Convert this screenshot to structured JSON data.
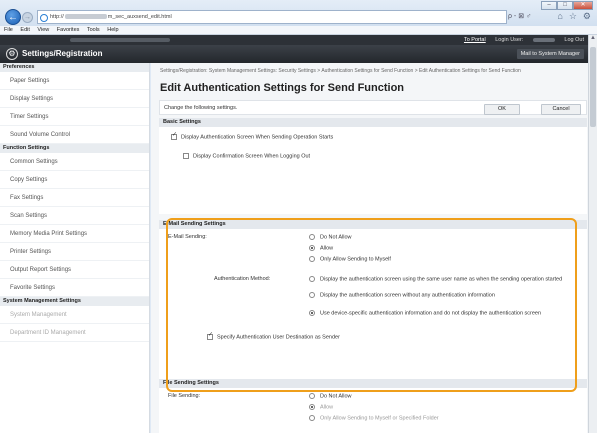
{
  "browser": {
    "url_prefix": "http://",
    "url_mid": "m_sec_auxsend_edit.html",
    "search_tools": "ρ - ⊠ ♂",
    "menu": [
      "File",
      "Edit",
      "View",
      "Favorites",
      "Tools",
      "Help"
    ]
  },
  "header": {
    "to_portal": "To Portal",
    "login_user_label": "Login User:",
    "logout": "Log Out",
    "app_title": "Settings/Registration",
    "mail_to_admin": "Mail to System Manager"
  },
  "sidebar": {
    "preferences_title": "Preferences",
    "preferences": [
      "Paper Settings",
      "Display Settings",
      "Timer Settings",
      "Sound Volume Control"
    ],
    "function_title": "Function Settings",
    "function": [
      "Common Settings",
      "Copy Settings",
      "Fax Settings",
      "Scan Settings",
      "Memory Media Print Settings",
      "Printer Settings",
      "Output Report Settings",
      "Favorite Settings"
    ],
    "sysmgmt_title": "System Management Settings",
    "sysmgmt": [
      "System Management",
      "Department ID Management"
    ]
  },
  "main": {
    "breadcrumb": "Settings/Registration: System Management Settings: Security Settings > Authentication Settings for Send Function > Edit Authentication Settings for Send Function",
    "title": "Edit Authentication Settings for Send Function",
    "change_text": "Change the following settings.",
    "ok": "OK",
    "cancel": "Cancel",
    "basic": {
      "title": "Basic Settings",
      "display_auth": "Display Authentication Screen When Sending Operation Starts",
      "display_confirm": "Display Confirmation Screen When Logging Out"
    },
    "email": {
      "title": "E-Mail Sending Settings",
      "sending_label": "E-Mail Sending:",
      "opt_not_allow": "Do Not Allow",
      "opt_allow": "Allow",
      "opt_only_myself": "Only Allow Sending to Myself",
      "auth_method_label": "Authentication Method:",
      "auth_opt1": "Display the authentication screen using the same user name as when the sending operation started",
      "auth_opt2": "Display the authentication screen without any authentication information",
      "auth_opt3": "Use device-specific authentication information and do not display the authentication screen",
      "specify_dest": "Specify Authentication User Destination as Sender"
    },
    "file": {
      "title": "File Sending Settings",
      "sending_label": "File Sending:",
      "opt_not_allow": "Do Not Allow",
      "opt_allow": "Allow",
      "opt_only": "Only Allow Sending to Myself or Specified Folder"
    }
  },
  "colors": {
    "highlight": "#ef9f1b",
    "header_dark": "#2d3137"
  }
}
